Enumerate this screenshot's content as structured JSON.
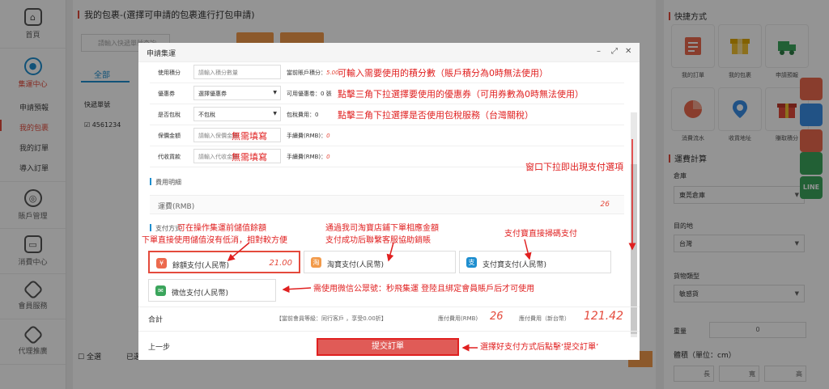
{
  "sidebar": {
    "home_label": "首頁",
    "jiyun_label": "集運中心",
    "items": [
      "申請預報",
      "我的包裹",
      "我的訂單",
      "導入訂單"
    ],
    "account_label": "賬戶管理",
    "spend_label": "消費中心",
    "member_label": "會員服務",
    "agent_label": "代理推廣"
  },
  "background": {
    "title": "我的包裹-(選擇可申請的包裹進行打包申請)",
    "search_placeholder": "請輸入快遞單號查詢",
    "tab_all": "全部",
    "col_tracking": "快遞單號",
    "row_tracking": "4561234",
    "select_all": "全選",
    "already": "已選"
  },
  "right_panel": {
    "quick_title": "快捷方式",
    "quick_items": [
      "我的訂單",
      "我的包裹",
      "申請預報",
      "消費流水",
      "收貨地址",
      "賺取積分"
    ],
    "calc_title": "運費計算",
    "warehouse_label": "倉庫",
    "warehouse_value": "東莞倉庫",
    "dest_label": "目的地",
    "dest_value": "台灣",
    "goods_label": "貨物類型",
    "goods_value": "敏感貨",
    "weight_label": "重量",
    "weight_value": "0",
    "volume_label": "體積（單位：cm）",
    "len_label": "長",
    "wid_label": "寬",
    "hei_label": "高"
  },
  "modal": {
    "title": "申請集運",
    "points_label": "使用積分",
    "points_placeholder": "請輸入積分數量",
    "points_meta_label": "當前賬戶積分：",
    "points_meta_value": "5.00",
    "coupon_label": "優惠券",
    "coupon_value": "選擇優惠券",
    "coupon_meta": "可用優惠卷：0 張",
    "tax_label": "是否包稅",
    "tax_value": "不包稅",
    "tax_meta": "包稅費用：0",
    "insure_label": "保價金額",
    "insure_placeholder": "請輸入保價金額",
    "insure_meta_label": "手續費(RMB)：",
    "insure_meta_value": "0",
    "cod_label": "代收貨款",
    "cod_placeholder": "請輸入代收金額",
    "cod_meta_label": "手續費(RMB)：",
    "cod_meta_value": "0",
    "fee_section": "費用明細",
    "freight_label": "運費(RMB)",
    "freight_value": "26",
    "pay_section": "支付方式",
    "pay_balance": "餘額支付(人民幣)",
    "pay_balance_amount": "21.00",
    "pay_taobao": "淘寶支付(人民幣)",
    "pay_alipay": "支付寶支付(人民幣)",
    "pay_wechat": "微信支付(人民幣)",
    "total_label": "合計",
    "member_level": "【當前會員等級：同行客戶 ，享受0.00折】",
    "due_rmb_label": "應付費用(RMB)",
    "due_rmb_value": "26",
    "due_twd_label": "應付費用（新台幣）",
    "due_twd_value": "121.42",
    "prev_label": "上一步",
    "submit_label": "提交訂單"
  },
  "annotations": {
    "points": "可輸入需要使用的積分數（賬戶積分為0時無法使用）",
    "coupon": "點擊三角下拉選擇要使用的優惠券（可用券數為0時無法使用）",
    "tax": "點擊三角下拉選擇是否使用包稅服務（台灣關稅）",
    "insure": "無需填寫",
    "cod": "無需填寫",
    "scroll": "窗口下拉即出現支付選項",
    "balance_1": "可在操作集運前儲值餘額",
    "balance_2": "下單直接使用儲值沒有低消，相對較方便",
    "taobao_1": "通過我司淘寶店鋪下單相應金額",
    "taobao_2": "支付成功后聯繫客服協助銷賬",
    "alipay": "支付寶直接掃碼支付",
    "wechat": "需使用微信公眾號：秒飛集運 登陸且綁定會員賬戶后才可使用",
    "submit": "選擇好支付方式后點擊‘提交訂單’"
  }
}
